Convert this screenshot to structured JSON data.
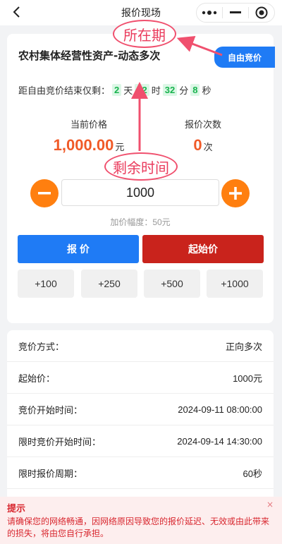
{
  "nav": {
    "title": "报价现场"
  },
  "auction": {
    "title": "农村集体经营性资产-动态多次",
    "tag": "自由竞价",
    "countdown": {
      "prefix": "距自由竞价结束仅剩：",
      "days": "2",
      "days_unit": "天",
      "hours": "22",
      "hours_unit": "时",
      "minutes": "32",
      "minutes_unit": "分",
      "seconds": "8",
      "seconds_unit": "秒"
    },
    "current_price": {
      "label": "当前价格",
      "value": "1,000.00",
      "unit": "元"
    },
    "bid_count": {
      "label": "报价次数",
      "value": "0",
      "unit": "次"
    },
    "amount_value": "1000",
    "step_hint": "加价幅度：50元",
    "bid_button": "报 价",
    "start_price_button": "起始价",
    "quick_adds": [
      "+100",
      "+250",
      "+500",
      "+1000"
    ]
  },
  "details": [
    {
      "label": "竞价方式：",
      "value": "正向多次"
    },
    {
      "label": "起始价：",
      "value": "1000元"
    },
    {
      "label": "竞价开始时间：",
      "value": "2024-09-11 08:00:00"
    },
    {
      "label": "限时竞价开始时间：",
      "value": "2024-09-14 14:30:00"
    },
    {
      "label": "限时报价周期：",
      "value": "60秒"
    }
  ],
  "tip": {
    "title": "提示",
    "text": "请确保您的网络畅通，因网络原因导致您的报价延迟、无效或由此带来的损失，将由您自行承担。",
    "close": "×"
  },
  "annotations": {
    "period": "所在期",
    "remaining": "剩余时间"
  },
  "colors": {
    "accent_blue": "#1f7bf5",
    "accent_red": "#c9231c",
    "price_orange": "#f05a28",
    "stepper_orange": "#ff7f0f",
    "countdown_green": "#17b34d",
    "annotation_pink": "#f0506e"
  }
}
